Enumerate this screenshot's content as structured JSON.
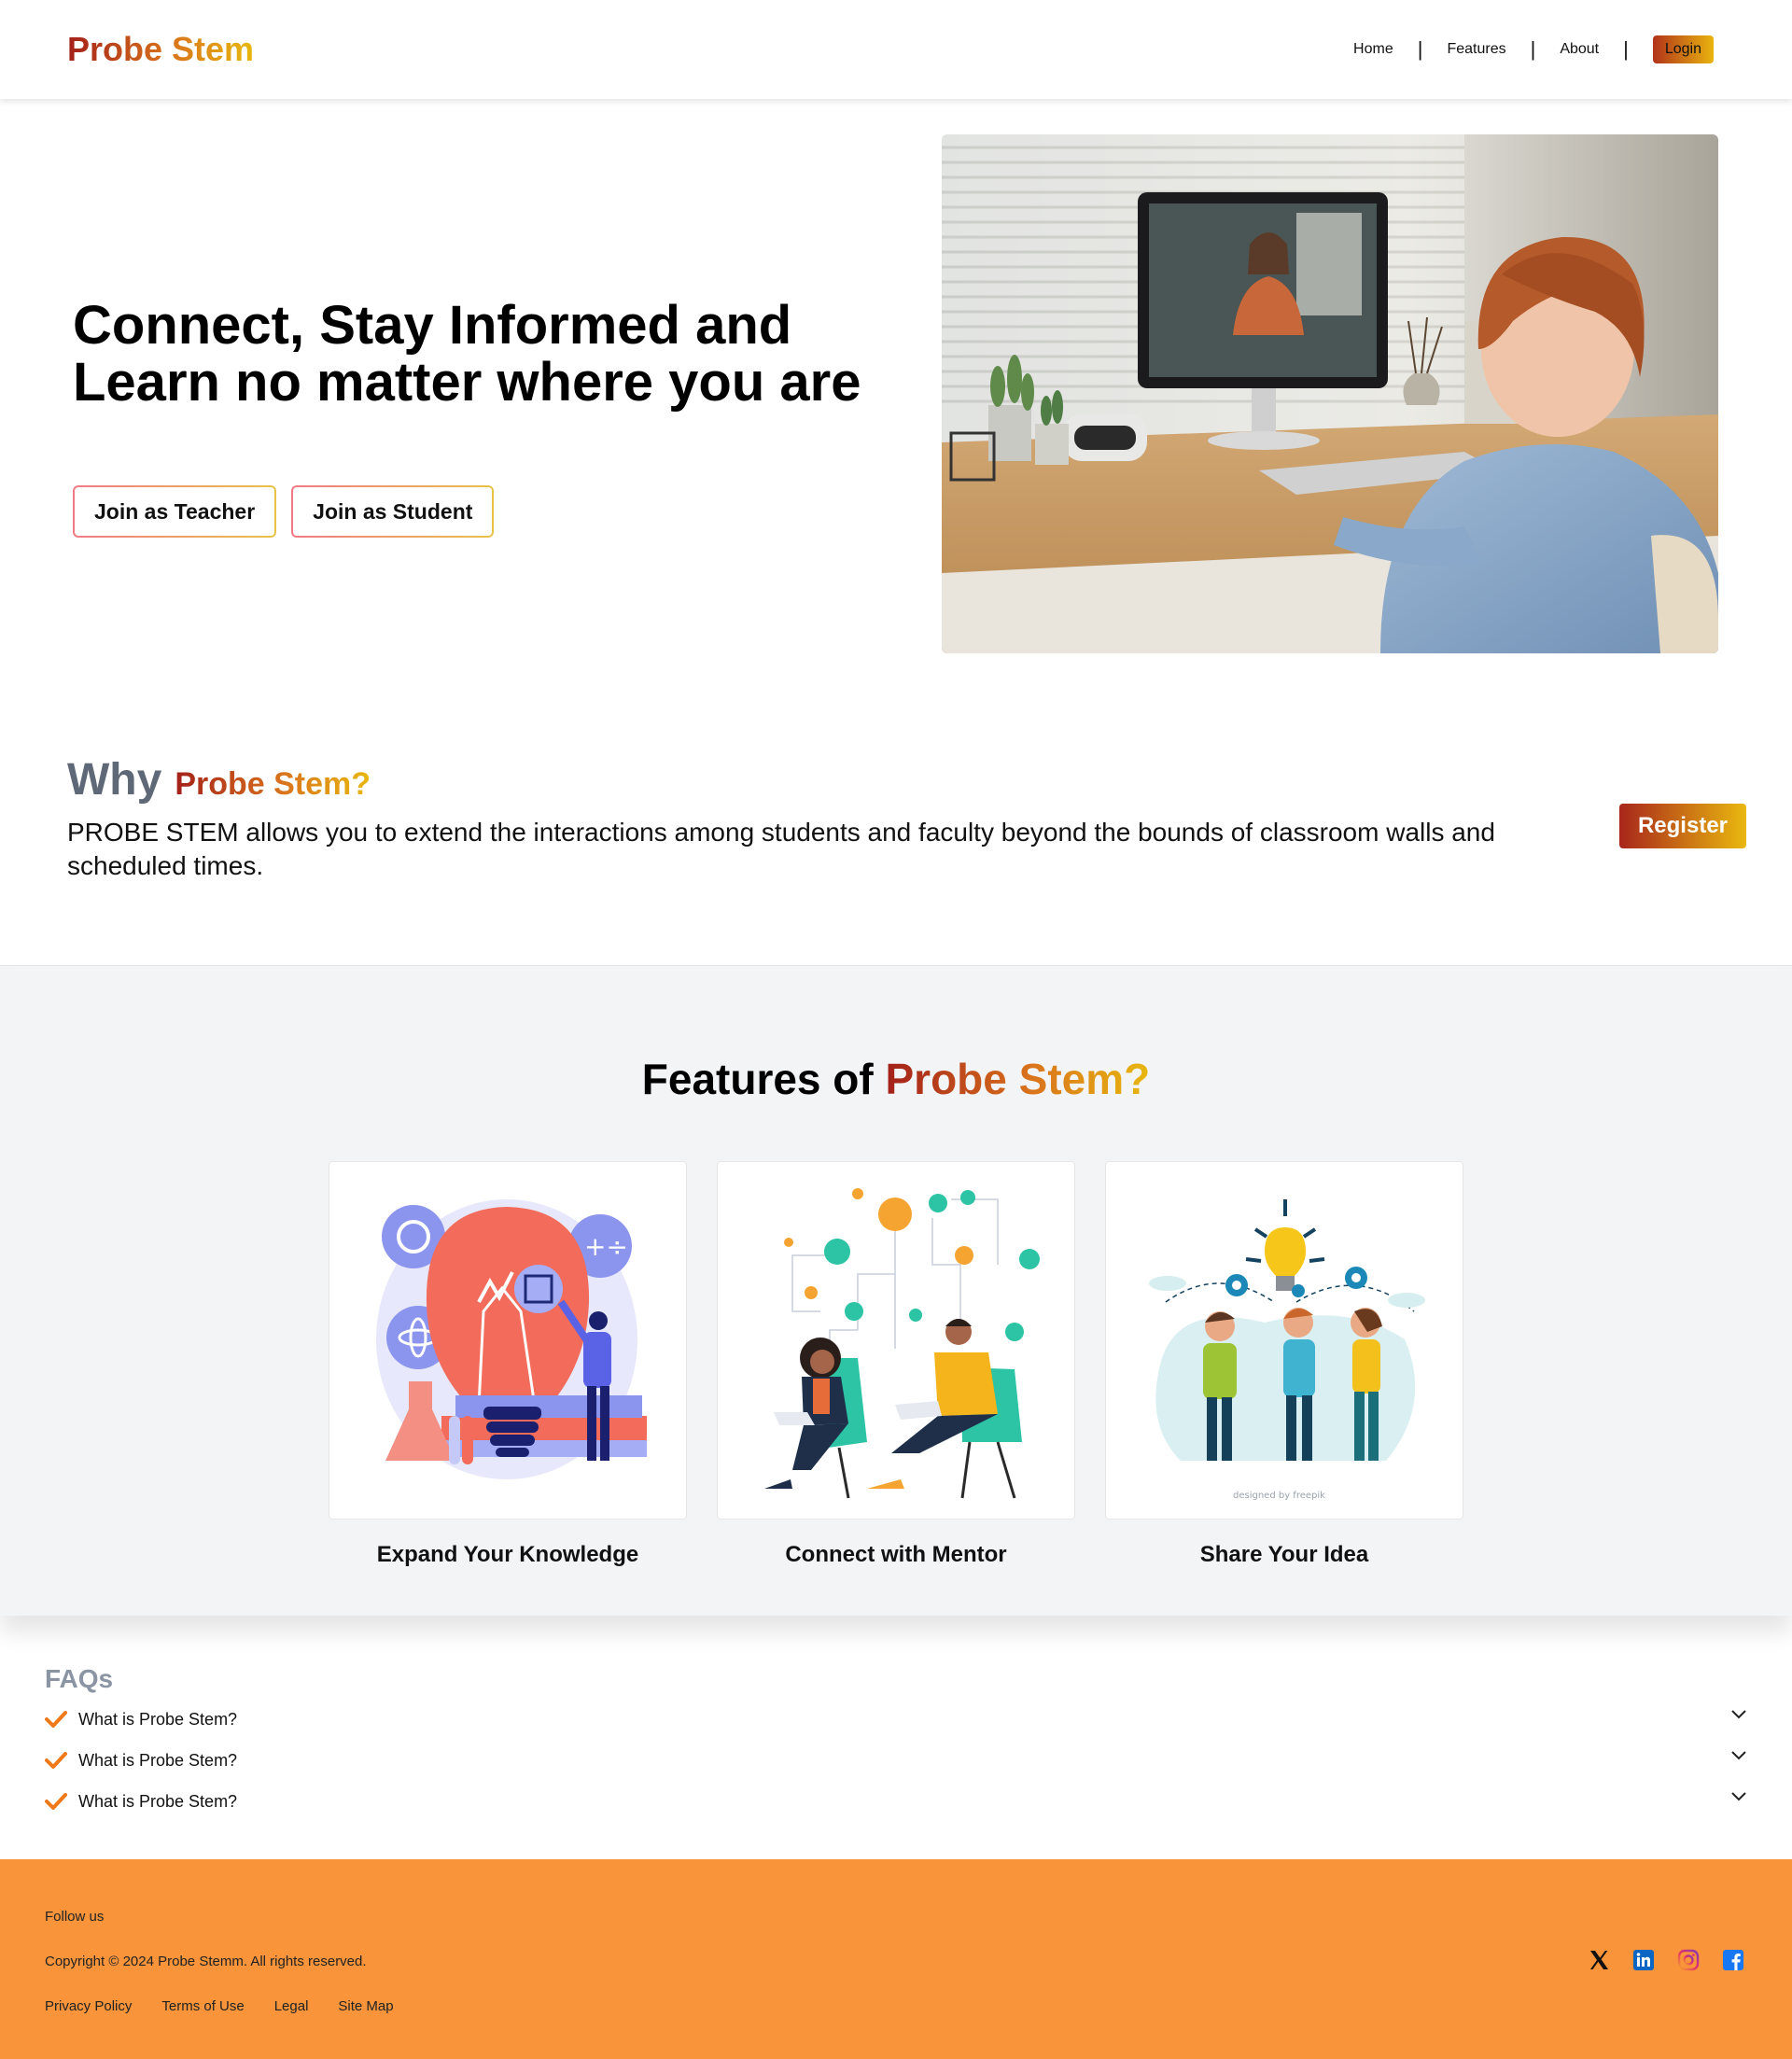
{
  "nav": {
    "brand": "Probe Stem",
    "links": [
      "Home",
      "Features",
      "About"
    ],
    "login": "Login"
  },
  "hero": {
    "title": "Connect, Stay Informed and Learn no matter where you are",
    "teacher_btn": "Join as Teacher",
    "student_btn": "Join as Student"
  },
  "why": {
    "word": "Why",
    "brand": "Probe Stem?",
    "text": "PROBE STEM allows you to extend the interactions among students and faculty beyond the bounds of classroom walls and scheduled times.",
    "register": "Register"
  },
  "features": {
    "title_prefix": "Features of",
    "title_brand": "Probe Stem?",
    "cards": [
      {
        "label": "Expand Your Knowledge",
        "illustration": "lightbulb-science-illustration"
      },
      {
        "label": "Connect with Mentor",
        "illustration": "mentor-network-illustration"
      },
      {
        "label": "Share Your Idea",
        "illustration": "idea-sharing-illustration",
        "credit": "designed by freepik"
      }
    ]
  },
  "faq": {
    "title": "FAQs",
    "items": [
      "What is Probe Stem?",
      "What is Probe Stem?",
      "What is Probe Stem?"
    ]
  },
  "footer": {
    "follow": "Follow us",
    "copyright": "Copyright © 2024 Probe Stemm. All rights reserved.",
    "links": [
      "Privacy Policy",
      "Terms of Use",
      "Legal",
      "Site Map"
    ],
    "socials": [
      "x-icon",
      "linkedin-icon",
      "instagram-icon",
      "facebook-icon"
    ]
  },
  "colors": {
    "brand_dark": "#a3201a",
    "brand_light": "#e8b80e",
    "footer_bg": "#f9943b",
    "faq_check": "#f07a1a"
  }
}
